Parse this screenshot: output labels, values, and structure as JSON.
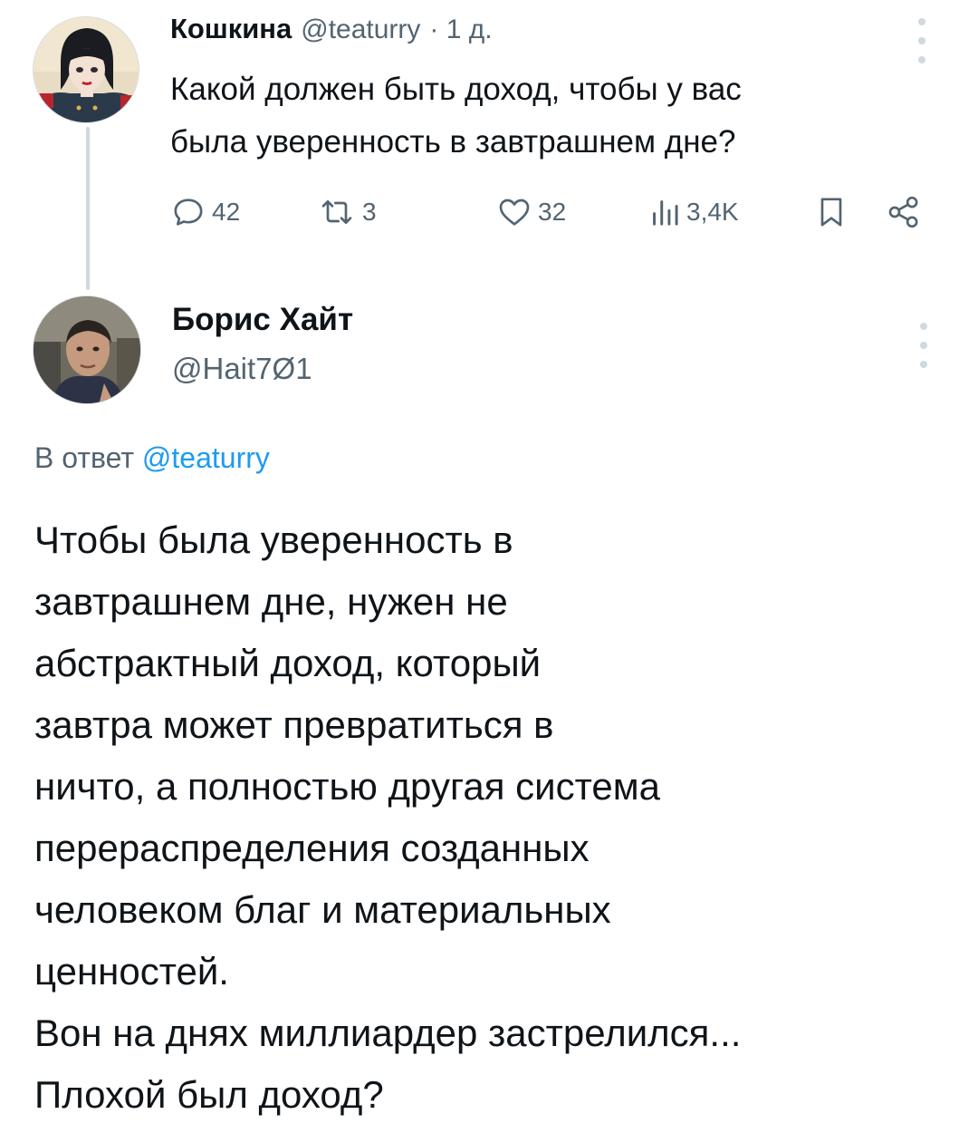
{
  "parent_tweet": {
    "author_name": "Кошкина",
    "handle": "@teaturry",
    "time": "· 1 д.",
    "lines": [
      "Какой должен быть доход, чтобы у вас",
      "была уверенность в завтрашнем дне?"
    ],
    "actions": {
      "replies": "42",
      "retweets": "3",
      "likes": "32",
      "views": "3,4K"
    }
  },
  "reply_tweet": {
    "author_name": "Борис Хайт",
    "handle": "@Hait7Ø1",
    "reply_prefix": "В ответ",
    "reply_mention": "@teaturry",
    "lines": [
      "Чтобы была уверенность в",
      "завтрашнем дне, нужен не",
      "абстрактный доход, который",
      "завтра может превратиться в",
      "ничто, а полностью другая система",
      "перераспределения созданных",
      "человеком благ и материальных",
      "ценностей.",
      "Вон на днях миллиардер застрелился...",
      "Плохой был доход?"
    ]
  },
  "icons": {
    "reply": "speech-bubble-icon",
    "retweet": "retweet-arrows-icon",
    "like": "heart-icon",
    "views": "bar-chart-icon",
    "bookmark": "bookmark-icon",
    "share": "share-icon",
    "more": "vertical-dots-icon"
  },
  "colors": {
    "text": "#0f1419",
    "secondary": "#536471",
    "link": "#1d9bf0",
    "thread_line": "#cfd9de"
  }
}
